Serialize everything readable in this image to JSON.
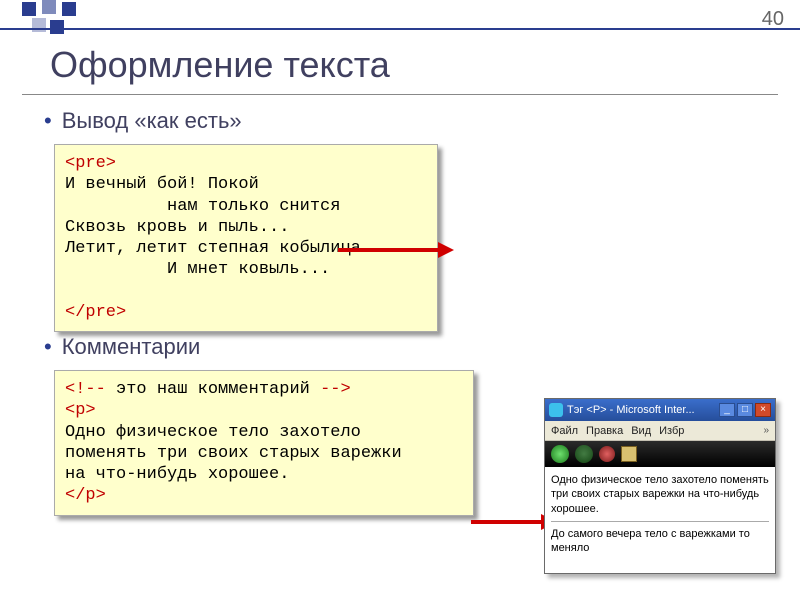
{
  "page_number": "40",
  "title": "Оформление текста",
  "bullets": {
    "b1": "Вывод «как есть»",
    "b2": "Комментарии"
  },
  "code1": {
    "open": "<pre>",
    "body": "И вечный бой! Покой\n          нам только снится\nСквозь кровь и пыль...\nЛетит, летит степная кобылица\n          И мнет ковыль...\n",
    "close": "</pre>"
  },
  "code2": {
    "comment_open": "<!--",
    "comment_text": " это наш комментарий ",
    "comment_close": "-->",
    "p_open": "<p>",
    "body": "Одно физическое тело захотело\nпоменять три своих старых варежки\nна что-нибудь хорошее.",
    "p_close": "</p>"
  },
  "mini": {
    "title": "Тэг <P> - Microsoft Inter...",
    "menu": {
      "file": "Файл",
      "edit": "Правка",
      "view": "Вид",
      "fav": "Избр"
    },
    "para1": "Одно физическое тело захотело поменять три своих старых варежки на что-нибудь хорошее.",
    "para2": "До самого вечера тело с варежками то меняло"
  }
}
